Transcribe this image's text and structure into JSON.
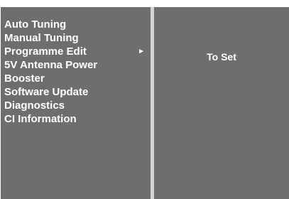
{
  "menu": {
    "items": [
      {
        "label": "Auto Tuning"
      },
      {
        "label": "Manual Tuning"
      },
      {
        "label": "Programme Edit",
        "arrow": "►"
      },
      {
        "label": "5V Antenna Power"
      },
      {
        "label": "Booster"
      },
      {
        "label": "Software Update"
      },
      {
        "label": "Diagnostics"
      },
      {
        "label": "CI Information"
      }
    ]
  },
  "submenu": {
    "value": "To Set"
  },
  "icons": {
    "arrow": "arrow-right-icon"
  },
  "colors": {
    "panel": "#6e6e6e",
    "divider": "#d2d2d2",
    "text": "#ffffff"
  }
}
